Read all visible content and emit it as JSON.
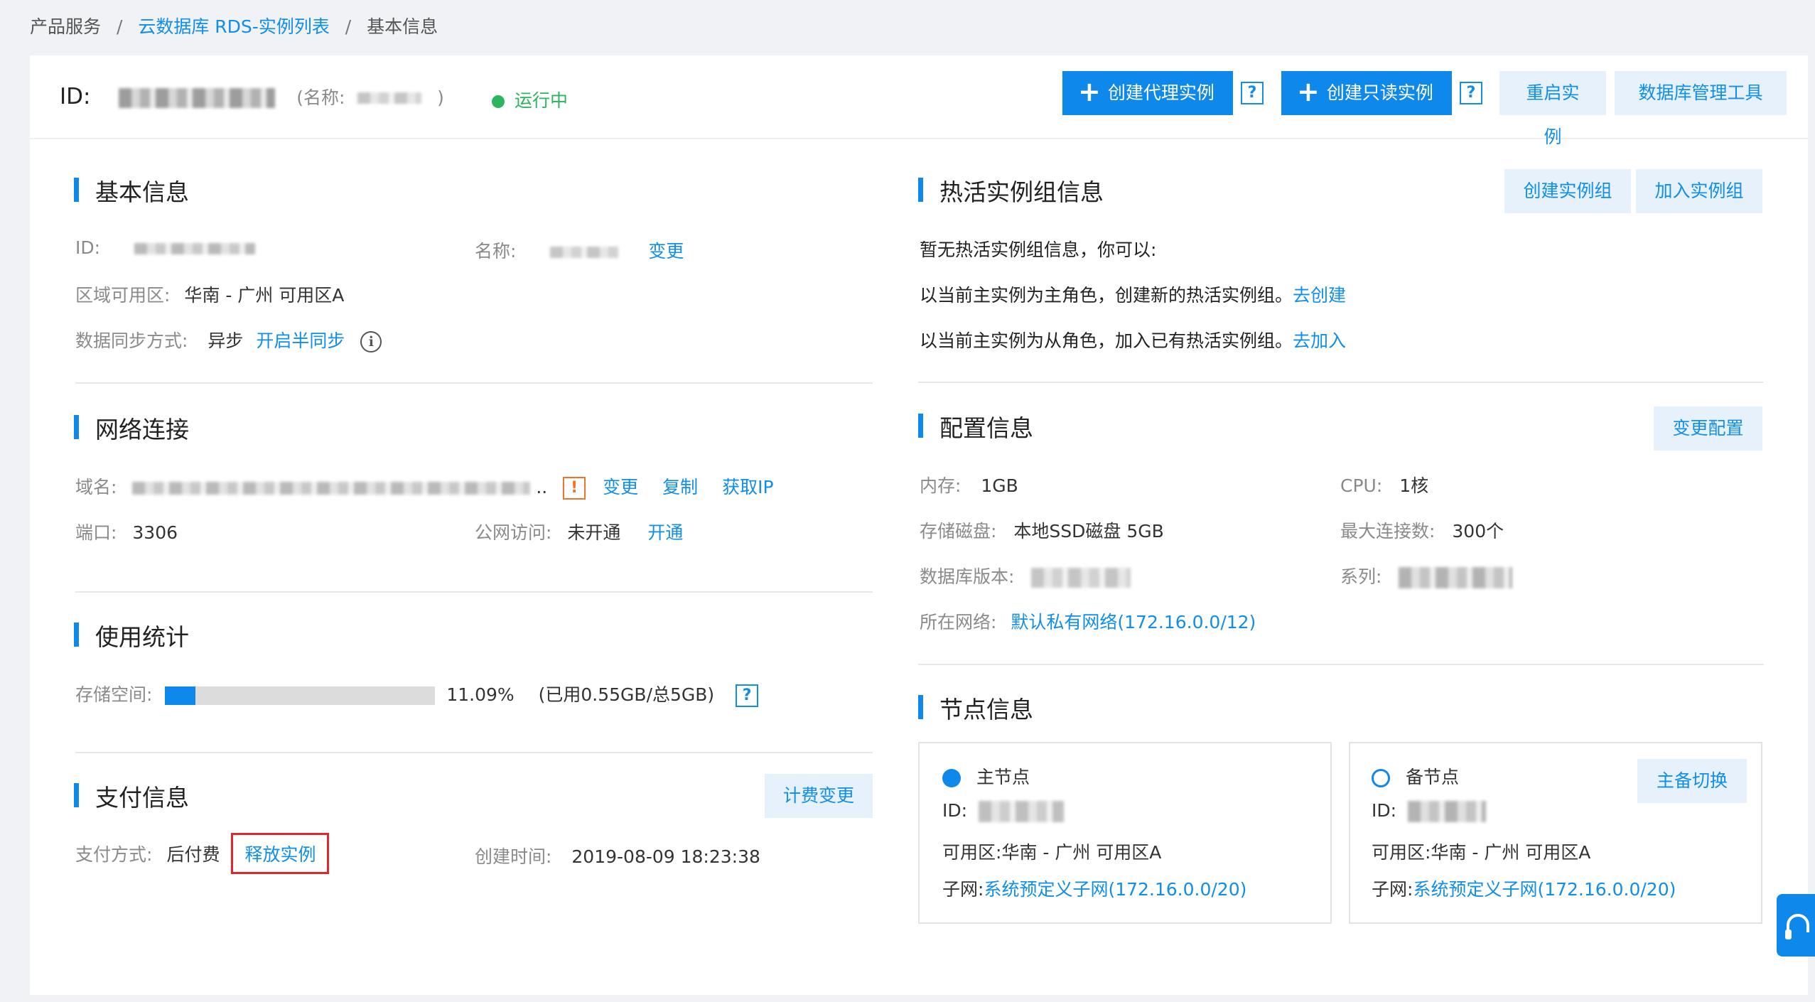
{
  "breadcrumb": {
    "item1": "产品服务",
    "item2": "云数据库 RDS-实例列表",
    "item3": "基本信息",
    "separator": "/"
  },
  "header": {
    "id_label": "ID:",
    "name_label": "(名称:",
    "name_close": ")",
    "status": "运行中",
    "buttons": {
      "create_proxy": "创建代理实例",
      "create_readonly": "创建只读实例",
      "restart": "重启实例",
      "db_tool": "数据库管理工具",
      "help": "?"
    }
  },
  "basic": {
    "title": "基本信息",
    "id_label": "ID:",
    "name_label": "名称:",
    "change": "变更",
    "region_label": "区域可用区:",
    "region_value": "华南 - 广州 可用区A",
    "sync_label": "数据同步方式:",
    "sync_value": "异步",
    "sync_action": "开启半同步"
  },
  "network": {
    "title": "网络连接",
    "domain_label": "域名:",
    "domain_ellipsis": "..",
    "change": "变更",
    "copy": "复制",
    "get_ip": "获取IP",
    "port_label": "端口:",
    "port_value": "3306",
    "public_label": "公网访问:",
    "public_value": "未开通",
    "public_action": "开通"
  },
  "usage": {
    "title": "使用统计",
    "storage_label": "存储空间:",
    "percent": "11.09%",
    "percent_value": 0.1109,
    "detail": "(已用0.55GB/总5GB)"
  },
  "payment": {
    "title": "支付信息",
    "billing_change": "计费变更",
    "method_label": "支付方式:",
    "method_value": "后付费",
    "release": "释放实例",
    "created_label": "创建时间:",
    "created_value": "2019-08-09 18:23:38"
  },
  "hotgroup": {
    "title": "热活实例组信息",
    "create_group": "创建实例组",
    "join_group": "加入实例组",
    "line1": "暂无热活实例组信息，你可以:",
    "line2": "以当前主实例为主角色，创建新的热活实例组。",
    "line2_link": "去创建",
    "line3": "以当前主实例为从角色，加入已有热活实例组。",
    "line3_link": "去加入"
  },
  "config": {
    "title": "配置信息",
    "change_config": "变更配置",
    "memory_label": "内存:",
    "memory_value": "1GB",
    "cpu_label": "CPU:",
    "cpu_value": "1核",
    "disk_label": "存储磁盘:",
    "disk_value": "本地SSD磁盘 5GB",
    "maxconn_label": "最大连接数:",
    "maxconn_value": "300个",
    "dbver_label": "数据库版本:",
    "series_label": "系列:",
    "vpc_label": "所在网络:",
    "vpc_value": "默认私有网络(172.16.0.0/12)"
  },
  "nodes": {
    "title": "节点信息",
    "primary": {
      "name": "主节点",
      "id_label": "ID:",
      "zone_label": "可用区:",
      "zone_value": "华南 - 广州 可用区A",
      "subnet_label": "子网:",
      "subnet_value": "系统预定义子网(172.16.0.0/20)"
    },
    "standby": {
      "name": "备节点",
      "id_label": "ID:",
      "zone_label": "可用区:",
      "zone_value": "华南 - 广州 可用区A",
      "subnet_label": "子网:",
      "subnet_value": "系统预定义子网(172.16.0.0/20)",
      "switch": "主备切换"
    }
  },
  "colors": {
    "accent": "#0f88eb",
    "status_running": "#2db55d",
    "warning": "#f0732a",
    "highlight_box": "#e0282e"
  },
  "icons": [
    "plus-icon",
    "help-icon",
    "info-icon",
    "warning-icon",
    "status-dot-icon",
    "radio-filled-icon",
    "radio-empty-icon",
    "headset-icon"
  ]
}
